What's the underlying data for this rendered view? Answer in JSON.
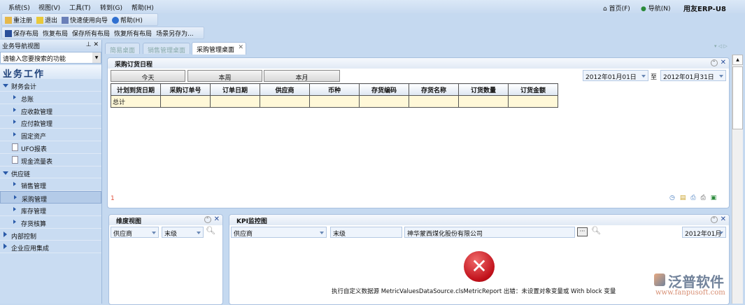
{
  "menu": [
    "系统(S)",
    "视图(V)",
    "工具(T)",
    "转到(G)",
    "帮助(H)"
  ],
  "toolbar1": [
    "重注册",
    "退出",
    "快速使用向导",
    "帮助(H)"
  ],
  "toolbar2": [
    "保存布局",
    "恢复布局",
    "保存所有布局",
    "恢复所有布局",
    "场景另存为..."
  ],
  "top_right": {
    "home": "首页(F)",
    "nav": "导航(N)",
    "brand": "用友ERP-U8"
  },
  "left": {
    "title": "业务导航视图",
    "search_placeholder": "请输入您要搜索的功能",
    "section": "业务工作",
    "items": [
      {
        "label": "财务会计",
        "type": "group"
      },
      {
        "label": "总账",
        "type": "sub"
      },
      {
        "label": "应收款管理",
        "type": "sub"
      },
      {
        "label": "应付款管理",
        "type": "sub"
      },
      {
        "label": "固定资产",
        "type": "sub"
      },
      {
        "label": "UFO报表",
        "type": "doc"
      },
      {
        "label": "现金流量表",
        "type": "doc"
      },
      {
        "label": "供应链",
        "type": "group"
      },
      {
        "label": "销售管理",
        "type": "sub"
      },
      {
        "label": "采购管理",
        "type": "sub",
        "selected": true
      },
      {
        "label": "库存管理",
        "type": "sub"
      },
      {
        "label": "存货核算",
        "type": "sub"
      },
      {
        "label": "内部控制",
        "type": "closed"
      },
      {
        "label": "企业应用集成",
        "type": "closed"
      }
    ]
  },
  "tabs": [
    "简易桌面",
    "销售管理桌面",
    "采购管理桌面"
  ],
  "schedule": {
    "title": "采购订货日程",
    "buttons": [
      "今天",
      "本周",
      "本月"
    ],
    "date_from": "2012年01月01日",
    "date_sep": "至",
    "date_to": "2012年01月31日",
    "columns": [
      "计划到货日期",
      "采购订单号",
      "订单日期",
      "供应商",
      "币种",
      "存货编码",
      "存货名称",
      "订货数量",
      "订货金额"
    ],
    "total_row": [
      "总计",
      "",
      "",
      "",
      "",
      "",
      "",
      "",
      ""
    ],
    "page": "1"
  },
  "dim": {
    "title": "维度视图",
    "field1": "供应商",
    "field2": "末级"
  },
  "kpi": {
    "title": "KPI监控图",
    "field1": "供应商",
    "field2": "末级",
    "company": "神华蒙西煤化股份有限公司",
    "period": "2012年01月",
    "error": "执行自定义数据源 MetricValuesDataSource.clsMetricReport 出错：未设置对象变量或 With block 变量"
  },
  "watermark": {
    "name": "泛普软件",
    "url": "www.fanpusoft.com"
  }
}
